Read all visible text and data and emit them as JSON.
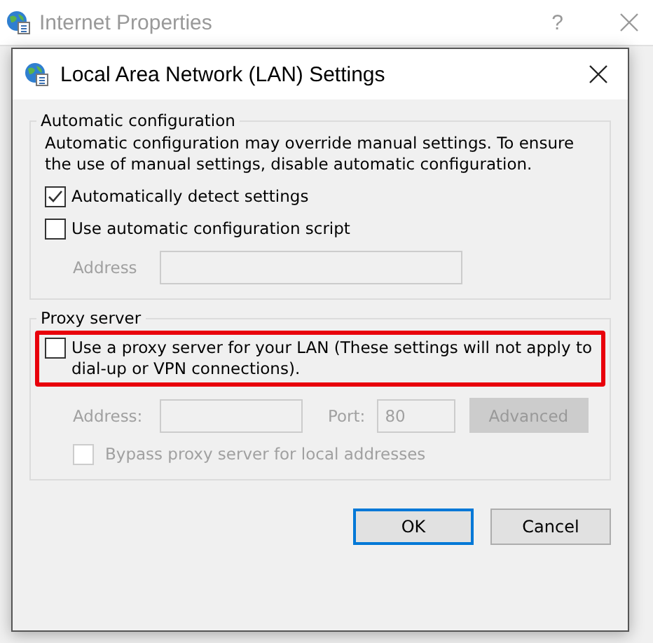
{
  "background_window": {
    "title": "Internet Properties",
    "help": "?"
  },
  "dialog": {
    "title": "Local Area Network (LAN) Settings"
  },
  "automatic": {
    "legend": "Automatic configuration",
    "description": "Automatic configuration may override manual settings.  To ensure the use of manual settings, disable automatic configuration.",
    "options": [
      {
        "label": "Automatically detect settings",
        "checked": true
      },
      {
        "label": "Use automatic configuration script",
        "checked": false
      }
    ],
    "address": {
      "label": "Address",
      "disabled": true
    }
  },
  "proxy": {
    "legend": "Proxy server",
    "option": {
      "label": "Use a proxy server for your LAN (These settings will not apply to dial-up or VPN connections).",
      "checked": false,
      "highlighted": true
    },
    "address": {
      "label": "Address:",
      "disabled": true
    },
    "port": {
      "label": "Port:",
      "value": "80",
      "disabled": true
    },
    "advanced": {
      "label": "Advanced",
      "disabled": true
    },
    "bypass": {
      "label": "Bypass proxy server for local addresses",
      "checked": false,
      "disabled": true
    }
  },
  "buttons": [
    {
      "label": "OK",
      "default": true
    },
    {
      "label": "Cancel",
      "default": false
    }
  ]
}
